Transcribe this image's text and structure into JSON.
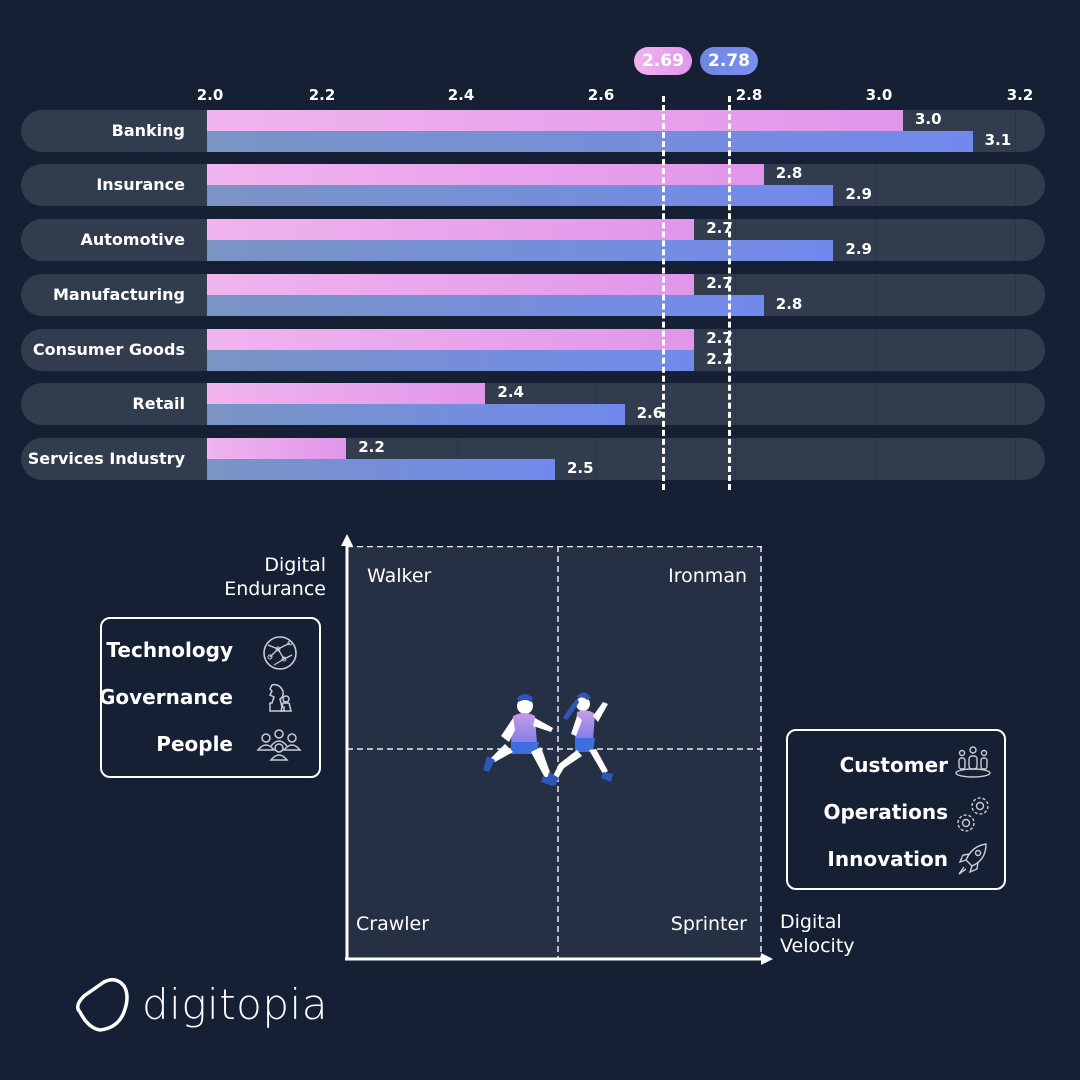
{
  "chart_data": {
    "type": "bar",
    "orientation": "horizontal",
    "title": "",
    "xlabel": "",
    "ylabel": "",
    "xlim": [
      2.0,
      3.2
    ],
    "xticks": [
      "2.0",
      "2.2",
      "2.4",
      "2.6",
      "2.8",
      "3.0",
      "3.2"
    ],
    "grid": true,
    "categories": [
      "Banking",
      "Insurance",
      "Automotive",
      "Manufacturing",
      "Consumer Goods",
      "Retail",
      "Services Industry"
    ],
    "series": [
      {
        "name": "Digital Endurance",
        "color": "#e9a6ec",
        "values": [
          3.0,
          2.8,
          2.7,
          2.7,
          2.7,
          2.4,
          2.2
        ],
        "labels": [
          "3.0",
          "2.8",
          "2.7",
          "2.7",
          "2.7",
          "2.4",
          "2.2"
        ]
      },
      {
        "name": "Digital Velocity",
        "color": "#7289ec",
        "values": [
          3.1,
          2.9,
          2.9,
          2.8,
          2.7,
          2.6,
          2.5
        ],
        "labels": [
          "3.1",
          "2.9",
          "2.9",
          "2.8",
          "2.7",
          "2.6",
          "2.5"
        ]
      }
    ],
    "reference_lines": [
      {
        "name": "average-endurance",
        "value": 2.69,
        "label": "2.69",
        "color": "#e9a6ec"
      },
      {
        "name": "average-velocity",
        "value": 2.78,
        "label": "2.78",
        "color": "#7289ec"
      }
    ]
  },
  "matrix": {
    "y_axis_label_line1": "Digital",
    "y_axis_label_line2": "Endurance",
    "x_axis_label_line1": "Digital",
    "x_axis_label_line2": "Velocity",
    "quadrants": {
      "top_left": "Walker",
      "top_right": "Ironman",
      "bottom_left": "Crawler",
      "bottom_right": "Sprinter"
    }
  },
  "legend_left": [
    {
      "label": "Technology",
      "icon": "globe-network-icon"
    },
    {
      "label": "Governance",
      "icon": "chess-knight-icon"
    },
    {
      "label": "People",
      "icon": "people-group-icon"
    }
  ],
  "legend_right": [
    {
      "label": "Customer",
      "icon": "customers-icon"
    },
    {
      "label": "Operations",
      "icon": "gears-icon"
    },
    {
      "label": "Innovation",
      "icon": "rocket-icon"
    }
  ],
  "brand": {
    "name": "digitopia"
  }
}
